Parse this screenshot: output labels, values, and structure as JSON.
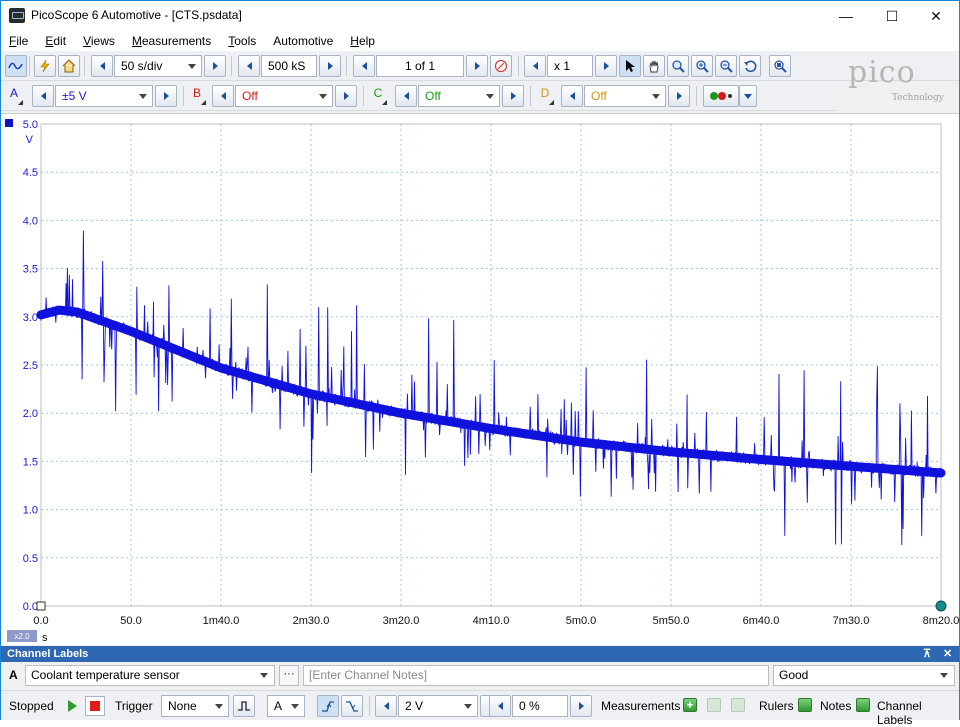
{
  "window": {
    "title": "PicoScope 6 Automotive - [CTS.psdata]",
    "controls": {
      "minimize": "—",
      "maximize": "☐",
      "close": "✕"
    }
  },
  "menu": {
    "items": [
      {
        "label": "File",
        "hotkey": "F",
        "rest": "ile"
      },
      {
        "label": "Edit",
        "hotkey": "E",
        "rest": "dit"
      },
      {
        "label": "Views",
        "hotkey": "V",
        "rest": "iews"
      },
      {
        "label": "Measurements",
        "hotkey": "M",
        "rest": "easurements"
      },
      {
        "label": "Tools",
        "hotkey": "T",
        "rest": "ools"
      },
      {
        "label": "Automotive",
        "hotkey": "",
        "rest": "Automotive"
      },
      {
        "label": "Help",
        "hotkey": "H",
        "rest": "elp"
      }
    ]
  },
  "toolbar1": {
    "timebase": "50 s/div",
    "samples": "500 kS",
    "buffer": "1 of 1",
    "zoom": "x 1"
  },
  "toolbar2": {
    "channels": [
      {
        "letter": "A",
        "range": "±5 V",
        "color": "#1a1ad6"
      },
      {
        "letter": "B",
        "range": "Off",
        "color": "#d61a1a"
      },
      {
        "letter": "C",
        "range": "Off",
        "color": "#1a9a1a"
      },
      {
        "letter": "D",
        "range": "Off",
        "color": "#c99a10"
      }
    ]
  },
  "logo": {
    "word": "pico",
    "sub": "Technology"
  },
  "chart_data": {
    "type": "line",
    "title": "",
    "xlabel": "s",
    "ylabel": "V",
    "xlim": [
      0,
      500
    ],
    "ylim": [
      0,
      5
    ],
    "y_ticks": [
      "0.0",
      "0.5",
      "1.0",
      "1.5",
      "2.0",
      "2.5",
      "3.0",
      "3.5",
      "4.0",
      "4.5",
      "5.0"
    ],
    "x_ticks": [
      "0.0",
      "50.0",
      "1m40.0",
      "2m30.0",
      "3m20.0",
      "4m10.0",
      "5m0.0",
      "5m50.0",
      "6m40.0",
      "7m30.0",
      "8m20.0"
    ],
    "x_zoom_label": "x2.0",
    "grid": true,
    "series": [
      {
        "channel": "A",
        "color": "#1111dd",
        "x": [
          0,
          10,
          20,
          50,
          100,
          150,
          200,
          250,
          300,
          350,
          400,
          450,
          500
        ],
        "y": [
          3.02,
          3.07,
          3.05,
          2.85,
          2.47,
          2.2,
          2.0,
          1.84,
          1.7,
          1.6,
          1.52,
          1.45,
          1.38
        ]
      }
    ]
  },
  "channel_labels": {
    "header": "Channel Labels",
    "pin": "⊼",
    "close": "✕",
    "row": {
      "letter": "A",
      "label": "Coolant temperature sensor",
      "notes_placeholder": "[Enter Channel Notes]",
      "dots": "···",
      "status": "Good"
    }
  },
  "statusbar": {
    "state": "Stopped",
    "trigger_label": "Trigger",
    "trigger_mode": "None",
    "trigger_channel": "A",
    "threshold": "2 V",
    "pretrigger": "0 %",
    "measurements_label": "Measurements",
    "rulers_label": "Rulers",
    "notes_label": "Notes",
    "channel_labels_label": "Channel Labels"
  }
}
